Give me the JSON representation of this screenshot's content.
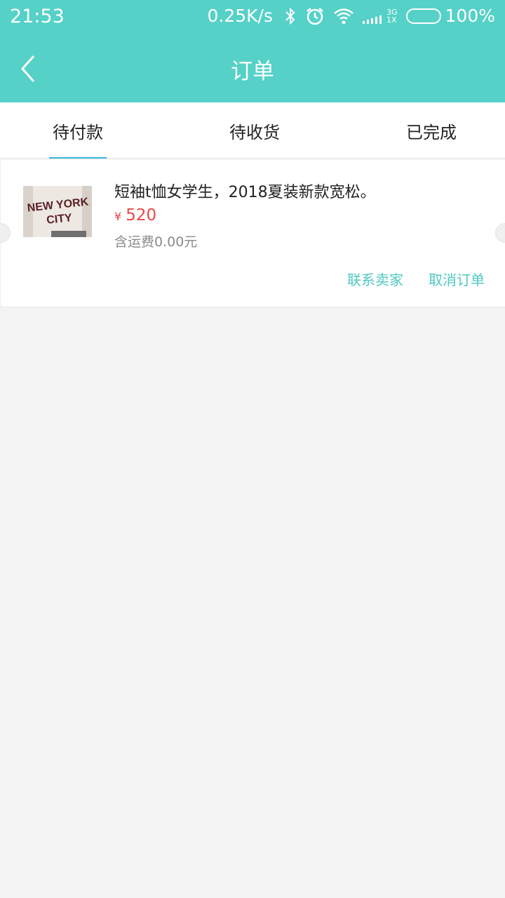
{
  "status_bar": {
    "time": "21:53",
    "net_speed": "0.25K/s",
    "signal_label_top": "3G",
    "signal_label_bottom": "1X",
    "battery_percent": "100%",
    "icons": [
      "bluetooth-icon",
      "alarm-icon",
      "wifi-icon",
      "signal-icon",
      "battery-icon"
    ]
  },
  "header": {
    "title": "订单",
    "back_icon": "chevron-left-icon"
  },
  "tabs": [
    {
      "label": "待付款",
      "active": true
    },
    {
      "label": "待收货",
      "active": false
    },
    {
      "label": "已完成",
      "active": false
    }
  ],
  "order": {
    "product_name": "短袖t恤女学生，2018夏装新款宽松。",
    "currency_symbol": "¥",
    "price": "520",
    "shipping_note": "含运费0.00元",
    "thumbnail_text_top": "NEW YORK",
    "thumbnail_text_bottom": "CITY",
    "actions": {
      "contact_seller": "联系卖家",
      "cancel_order": "取消订单"
    }
  },
  "colors": {
    "accent": "#55d1c7",
    "tab_indicator": "#34b5d6",
    "price": "#e8484a",
    "action_text": "#4ec8bf",
    "background": "#f3f3f3"
  }
}
